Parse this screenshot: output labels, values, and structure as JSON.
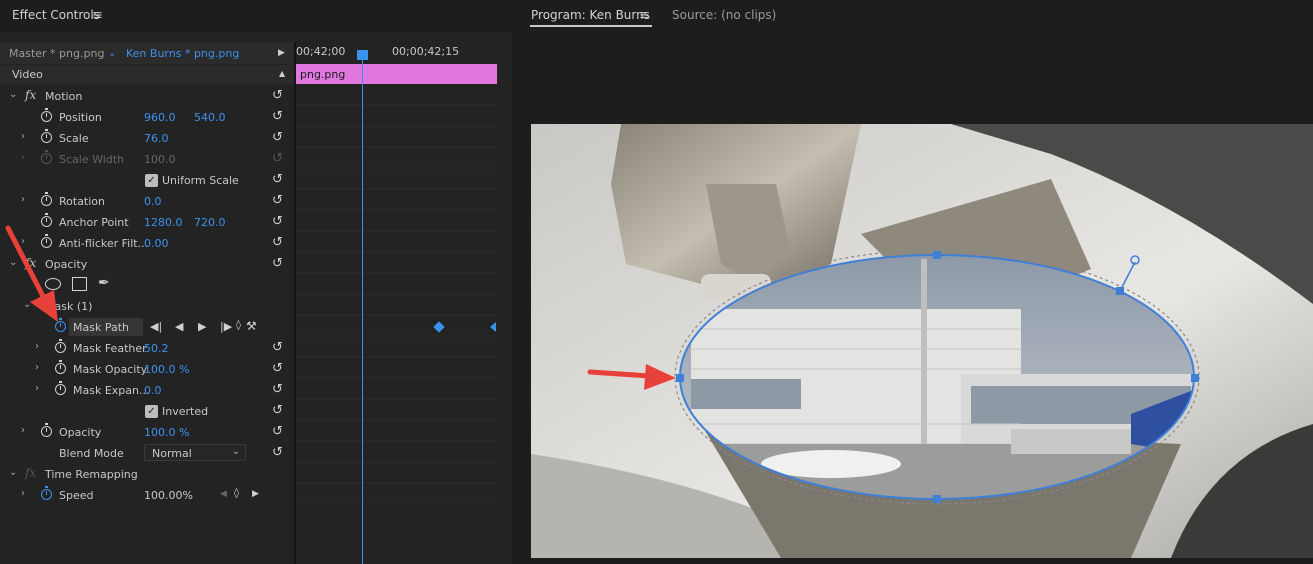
{
  "effect_controls": {
    "title": "Effect Controls",
    "clip_tabs": {
      "master": "Master * png.png",
      "sequence": "Ken Burns * png.png"
    },
    "section": "Video",
    "timecodes": {
      "start": "00;42;00",
      "end": "00;00;42;15"
    },
    "clip_name": "png.png",
    "motion": {
      "label": "Motion",
      "position": {
        "label": "Position",
        "x": "960.0",
        "y": "540.0"
      },
      "scale": {
        "label": "Scale",
        "value": "76.0"
      },
      "scale_width": {
        "label": "Scale Width",
        "value": "100.0"
      },
      "uniform_scale": {
        "label": "Uniform Scale",
        "checked": true
      },
      "rotation": {
        "label": "Rotation",
        "value": "0.0"
      },
      "anchor_point": {
        "label": "Anchor Point",
        "x": "1280.0",
        "y": "720.0"
      },
      "anti_flicker": {
        "label": "Anti-flicker Filt...",
        "value": "0.00"
      }
    },
    "opacity": {
      "label": "Opacity",
      "mask": {
        "label": "Mask (1)",
        "mask_path": "Mask Path",
        "mask_feather": {
          "label": "Mask Feather",
          "value": "50.2"
        },
        "mask_opacity": {
          "label": "Mask Opacity",
          "value": "100.0 %"
        },
        "mask_expansion": {
          "label": "Mask Expan...",
          "value": "0.0"
        },
        "inverted": {
          "label": "Inverted",
          "checked": true
        }
      },
      "opacity_prop": {
        "label": "Opacity",
        "value": "100.0 %"
      },
      "blend_mode": {
        "label": "Blend Mode",
        "value": "Normal"
      }
    },
    "time_remapping": {
      "label": "Time Remapping",
      "speed": {
        "label": "Speed",
        "value": "100.00%"
      }
    }
  },
  "program_monitor": {
    "tab_program": "Program: Ken Burns",
    "tab_source": "Source: (no clips)"
  },
  "colors": {
    "accent": "#3b92ee",
    "clip": "#e178e0",
    "annotation_arrow": "#e8413a",
    "mask": "#3f7fd8"
  }
}
